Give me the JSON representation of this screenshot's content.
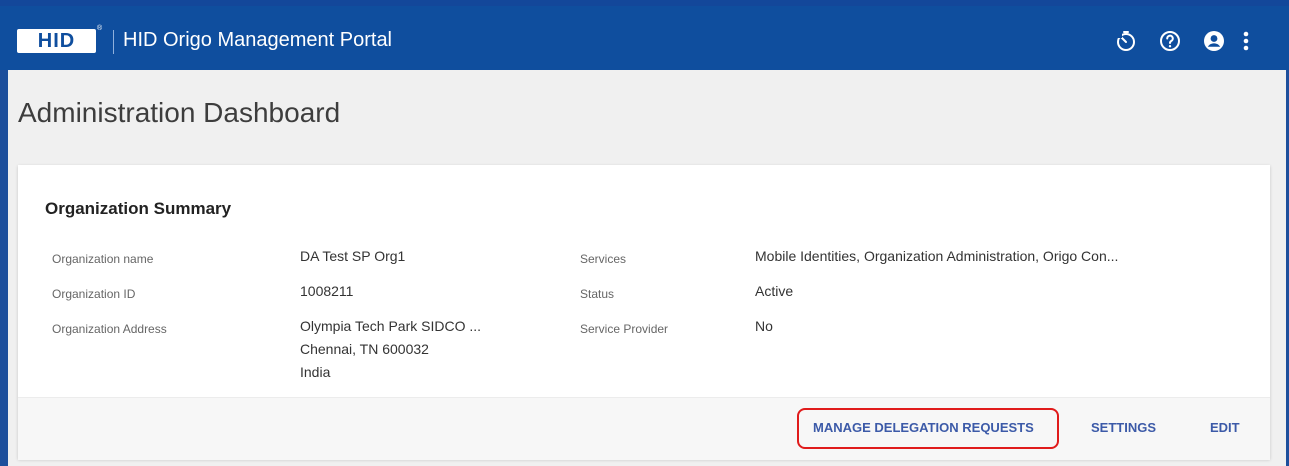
{
  "header": {
    "logo_text": "HID",
    "logo_tm": "®",
    "portal_title": "HID Origo Management Portal",
    "icons": [
      "timer-icon",
      "help-icon",
      "account-icon",
      "more-vert-icon"
    ],
    "bar_color": "#0f4e9e"
  },
  "page": {
    "title": "Administration Dashboard"
  },
  "summary": {
    "title": "Organization Summary",
    "fields": {
      "org_name_label": "Organization name",
      "org_name_value": "DA Test SP Org1",
      "org_id_label": "Organization ID",
      "org_id_value": "1008211",
      "org_address_label": "Organization Address",
      "org_address_line1": "Olympia Tech Park SIDCO ...",
      "org_address_line2": "Chennai, TN 600032",
      "org_address_line3": "India",
      "services_label": "Services",
      "services_value": "Mobile Identities, Organization Administration, Origo Con...",
      "status_label": "Status",
      "status_value": "Active",
      "service_provider_label": "Service Provider",
      "service_provider_value": "No"
    },
    "actions": {
      "manage_delegation": "MANAGE DELEGATION REQUESTS",
      "settings": "SETTINGS",
      "edit": "EDIT"
    },
    "highlight_color": "#e01b1b"
  }
}
